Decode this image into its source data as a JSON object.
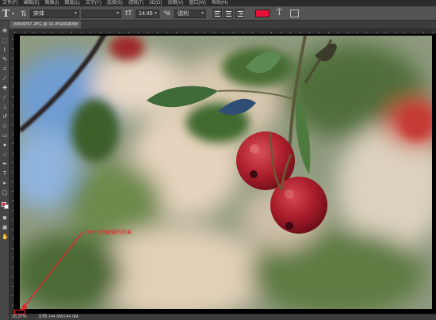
{
  "menubar": {
    "items": [
      "文件(F)",
      "编辑(E)",
      "图像(I)",
      "图层(L)",
      "文字(Y)",
      "选择(S)",
      "滤镜(T)",
      "3D(D)",
      "视图(V)",
      "窗口(W)",
      "帮助(H)"
    ]
  },
  "options": {
    "font_family": "宋体",
    "font_style": "",
    "font_size": "14.45",
    "anti_alias": "锐利",
    "text_color": "#e8113a"
  },
  "document": {
    "tab_title": "15848257.JPG @ 15.4%(RGB/8)",
    "tab_close": "×"
  },
  "annotation": {
    "text": "ctrl+0快捷键的效果"
  },
  "status": {
    "zoom": "15.37%",
    "doc_info": "文档:144.0M/144.0M",
    "caret": "›"
  },
  "icons": {
    "tool": "type-tool-icon",
    "orientation": "text-orientation-icon",
    "warp": "warp-text-icon",
    "panels": "character-panel-icon"
  },
  "colors": {
    "accent_red": "#e8113a",
    "annotation_red": "#e8232e"
  }
}
